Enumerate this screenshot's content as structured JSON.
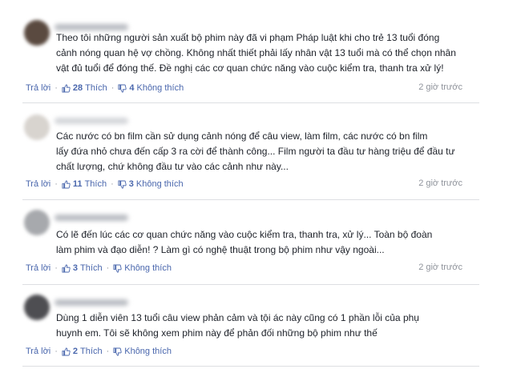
{
  "comments": [
    {
      "lines": [
        "Theo tôi những người sản xuất bộ phim này đã vi phạm Pháp luật khi cho trẻ 13 tuổi đóng",
        "cảnh nóng quan hệ vợ chồng. Không nhất thiết phải lấy nhân vật 13 tuổi mà có thể chọn nhân",
        "vật đủ tuổi để đóng thế. Đề nghị các cơ quan chức năng vào cuộc kiểm tra, thanh tra xử lý!"
      ],
      "reply_label": "Trả lời",
      "like_count": "28",
      "like_label": "Thích",
      "dislike_count": "4",
      "dislike_label": "Không thích",
      "time": "2 giờ trước"
    },
    {
      "lines": [
        "Các nước có bn film cần sử dụng cảnh nóng để câu view, làm film, các nước có bn film",
        "lấy đứa nhỏ chưa đến cấp 3 ra cời để thành công... Film người ta đầu tư hàng triệu để đầu tư",
        "chất lượng, chứ không đầu tư vào các cảnh như này..."
      ],
      "reply_label": "Trả lời",
      "like_count": "11",
      "like_label": "Thích",
      "dislike_count": "3",
      "dislike_label": "Không thích",
      "time": "2 giờ trước"
    },
    {
      "lines": [
        "Có lẽ đến lúc các cơ quan chức năng vào cuộc kiểm tra, thanh tra, xử lý... Toàn bộ đoàn",
        "làm phim và đạo diễn! ? Làm gì có nghệ thuật trong bộ phim như vậy ngoài..."
      ],
      "reply_label": "Trả lời",
      "like_count": "3",
      "like_label": "Thích",
      "dislike_count": "",
      "dislike_label": "Không thích",
      "time": "2 giờ trước"
    },
    {
      "lines": [
        "Dùng 1 diễn viên 13 tuổi câu view phản cảm và tội ác này cũng có 1 phần lỗi của phụ",
        "huynh em. Tôi sẽ không xem phim này để phản đối những bộ phim như thế"
      ],
      "reply_label": "Trả lời",
      "like_count": "2",
      "like_label": "Thích",
      "dislike_count": "",
      "dislike_label": "Không thích",
      "time": ""
    }
  ],
  "colors": {
    "link": "#4a67ad",
    "meta": "#90949c",
    "text": "#1d2129"
  },
  "icons": {
    "like": "thumbs-up-icon",
    "dislike": "thumbs-down-icon"
  }
}
